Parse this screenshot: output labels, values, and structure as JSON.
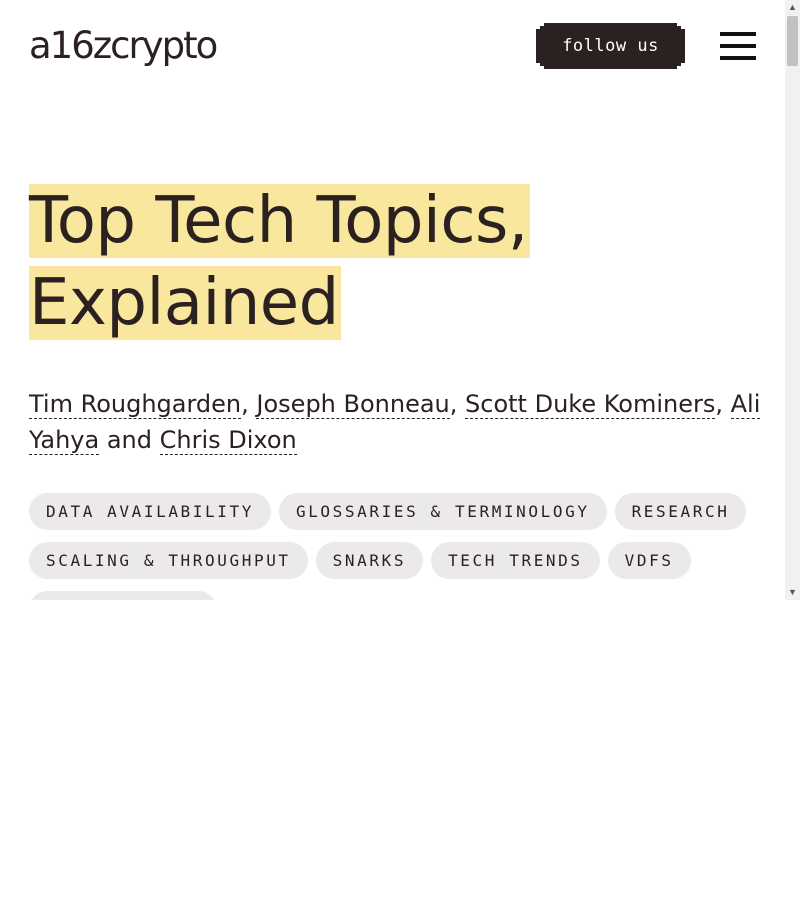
{
  "header": {
    "logo_text": "a16zcrypto",
    "follow_label": "follow us",
    "menu_icon": "hamburger-menu-icon"
  },
  "article": {
    "title_line1": "Top Tech Topics,",
    "title_line2": "Explained",
    "authors": [
      "Tim Roughgarden",
      "Joseph Bonneau",
      "Scott Duke Kominers",
      "Ali Yahya",
      "Chris Dixon"
    ],
    "author_sep": ", ",
    "author_and": " and ",
    "tags": [
      "DATA AVAILABILITY",
      "GLOSSARIES & TERMINOLOGY",
      "RESEARCH",
      "SCALING & THROUGHPUT",
      "SNARKS",
      "TECH TRENDS",
      "VDFS",
      ""
    ]
  },
  "colors": {
    "ink": "#2b2121",
    "highlight": "#f9e79d",
    "tag_bg": "#ebe9e9",
    "button_bg": "#2b2121"
  },
  "scrollbar": {
    "up_glyph": "▲",
    "down_glyph": "▼"
  }
}
